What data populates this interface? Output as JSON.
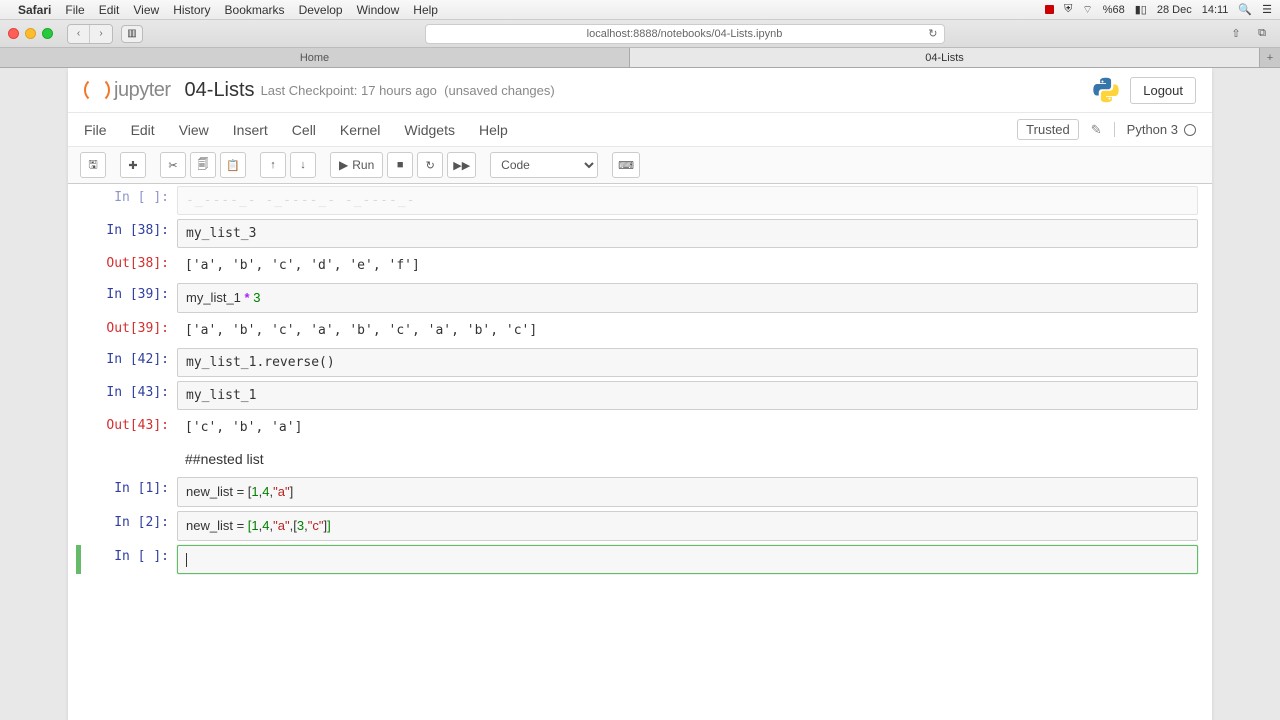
{
  "mac_menu": {
    "app": "Safari",
    "items": [
      "File",
      "Edit",
      "View",
      "History",
      "Bookmarks",
      "Develop",
      "Window",
      "Help"
    ],
    "battery": "%68",
    "date": "28 Dec",
    "time": "14:11"
  },
  "address": "localhost:8888/notebooks/04-Lists.ipynb",
  "tabs": {
    "left": "Home",
    "right": "04-Lists"
  },
  "nb": {
    "logo": "jupyter",
    "title": "04-Lists",
    "checkpoint": "Last Checkpoint: 17 hours ago",
    "unsaved": "(unsaved changes)",
    "logout": "Logout",
    "trusted": "Trusted",
    "kernel": "Python 3",
    "menu": [
      "File",
      "Edit",
      "View",
      "Insert",
      "Cell",
      "Kernel",
      "Widgets",
      "Help"
    ],
    "run": "Run",
    "celltype": "Code"
  },
  "cells": {
    "c0_in": "In [  ]:",
    "c0_code": "-_----_-  -_----_-  -_----_-",
    "c1_in": "In [38]:",
    "c1_code": "my_list_3",
    "c1_out": "Out[38]:",
    "c1_result": "['a', 'b', 'c', 'd', 'e', 'f']",
    "c2_in": "In [39]:",
    "c2_code_a": "my_list_1 ",
    "c2_code_op": "*",
    "c2_code_b": " 3",
    "c2_out": "Out[39]:",
    "c2_result": "['a', 'b', 'c', 'a', 'b', 'c', 'a', 'b', 'c']",
    "c3_in": "In [42]:",
    "c3_code": "my_list_1.reverse()",
    "c4_in": "In [43]:",
    "c4_code": "my_list_1",
    "c4_out": "Out[43]:",
    "c4_result": "['c', 'b', 'a']",
    "md_heading": "##nested list",
    "c5_in": "In [1]:",
    "c5_a": "new_list = [",
    "c5_n1": "1",
    "c5_c1": ",",
    "c5_n2": "4",
    "c5_c2": ",",
    "c5_s": "\"a\"",
    "c5_b": "]",
    "c6_in": "In [2]:",
    "c6_a": "new_list = ",
    "c6_lb": "[",
    "c6_n1": "1",
    "c6_c1": ",",
    "c6_n2": "4",
    "c6_c2": ",",
    "c6_s1": "\"a\"",
    "c6_c3": ",[",
    "c6_n3": "3",
    "c6_c4": ",",
    "c6_s2": "\"c\"",
    "c6_rb": "]",
    "c6_rb2": "]",
    "c7_in": "In [ ]:"
  }
}
